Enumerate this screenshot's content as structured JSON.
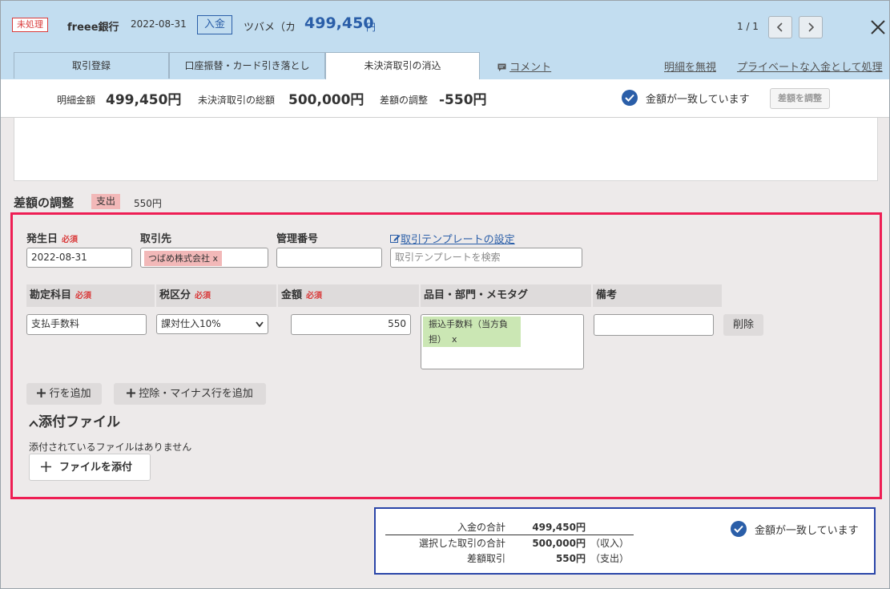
{
  "header": {
    "status_badge": "未処理",
    "bank_name": "freee銀行",
    "date": "2022-08-31",
    "type_badge": "入金",
    "partner": "ツバメ（カ",
    "amount": "499,450",
    "yen": "円",
    "pager": "1 / 1",
    "prev_icon": "chevron-left-icon",
    "next_icon": "chevron-right-icon",
    "close_icon": "close-icon",
    "tabs": [
      "取引登録",
      "口座振替・カード引き落とし",
      "未決済取引の消込"
    ],
    "active_tab": 2,
    "comment_label": "コメント",
    "ignore_link": "明細を無視",
    "private_link": "プライベートな入金として処理"
  },
  "summary": {
    "statement_label": "明細金額",
    "statement_value": "499,450円",
    "unsettled_label": "未決済取引の総額",
    "unsettled_value": "500,000円",
    "adjust_label": "差額の調整",
    "adjust_value": "-550円",
    "match_text": "金額が一致しています",
    "adjust_button": "差額を調整"
  },
  "adjustment": {
    "title": "差額の調整",
    "type_tag": "支出",
    "amount": "550円",
    "required_tag": "必須",
    "labels": {
      "date": "発生日",
      "partner": "取引先",
      "mgmt_no": "管理番号",
      "template_link": "取引テンプレートの設定"
    },
    "date_value": "2022-08-31",
    "partner_chip": "つばめ株式会社",
    "chip_remove": "x",
    "mgmt_no_value": "",
    "template_placeholder": "取引テンプレートを検索",
    "columns": {
      "account": "勘定科目",
      "tax": "税区分",
      "amount": "金額",
      "tags": "品目・部門・メモタグ",
      "note": "備考"
    },
    "row": {
      "account": "支払手数料",
      "tax": "課対仕入10%",
      "amount": "550",
      "tag_line1": "振込手数料（当方負",
      "tag_line2": "担）",
      "note": "",
      "delete_label": "削除"
    },
    "add_row": "行を追加",
    "add_minus_row": "控除・マイナス行を追加"
  },
  "attachments": {
    "title": "添付ファイル",
    "empty": "添付されているファイルはありません",
    "add_button": "ファイルを添付"
  },
  "totals": {
    "deposit_label": "入金の合計",
    "deposit_value": "499,450円",
    "selected_label": "選択した取引の合計",
    "selected_value": "500,000円",
    "selected_suffix": "（収入）",
    "diff_label": "差額取引",
    "diff_value": "550円",
    "diff_suffix": "（支出）",
    "match_text": "金額が一致しています"
  },
  "colors": {
    "header_bg": "#c2ddf0",
    "accent_blue": "#2a5ea8",
    "highlight_border": "#ee1e54",
    "required_red": "#d93a3a",
    "tag_green": "#cbe7b4"
  }
}
